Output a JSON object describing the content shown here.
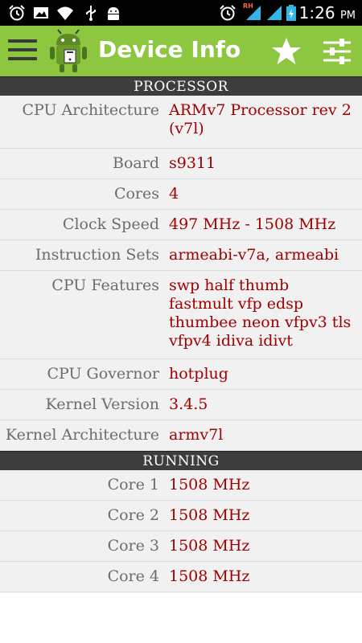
{
  "status_bar": {
    "time": "1:26",
    "ampm": "PM",
    "signal_label": "RH"
  },
  "action_bar": {
    "title": "Device Info"
  },
  "sections": {
    "processor": {
      "header": "PROCESSOR",
      "rows": [
        {
          "label": "CPU Architecture",
          "value": "ARMv7 Processor rev 2 (v7l)"
        },
        {
          "label": "Board",
          "value": "s9311"
        },
        {
          "label": "Cores",
          "value": "4"
        },
        {
          "label": "Clock Speed",
          "value": "497 MHz - 1508 MHz"
        },
        {
          "label": "Instruction Sets",
          "value": "armeabi-v7a, armeabi"
        },
        {
          "label": "CPU Features",
          "value": "swp half thumb fastmult vfp edsp thumbee neon vfpv3 tls vfpv4 idiva idivt"
        },
        {
          "label": "CPU Governor",
          "value": "hotplug"
        },
        {
          "label": "Kernel Version",
          "value": "3.4.5"
        },
        {
          "label": "Kernel Architecture",
          "value": "armv7l"
        }
      ]
    },
    "running": {
      "header": "RUNNING",
      "rows": [
        {
          "label": "Core 1",
          "value": "1508 MHz"
        },
        {
          "label": "Core 2",
          "value": "1508 MHz"
        },
        {
          "label": "Core 3",
          "value": "1508 MHz"
        },
        {
          "label": "Core 4",
          "value": "1508 MHz"
        }
      ]
    }
  },
  "colors": {
    "action_bar": "#8dc63f",
    "section_header": "#3d3d3d",
    "value_text": "#a00000",
    "label_text": "#6c6c6c"
  },
  "icons": [
    "alarm-icon",
    "gallery-icon",
    "wifi-icon",
    "usb-icon",
    "android-icon",
    "alarm-icon",
    "signal-icon",
    "battery-icon",
    "menu-icon",
    "app-logo-icon",
    "star-icon",
    "settings-sliders-icon"
  ]
}
